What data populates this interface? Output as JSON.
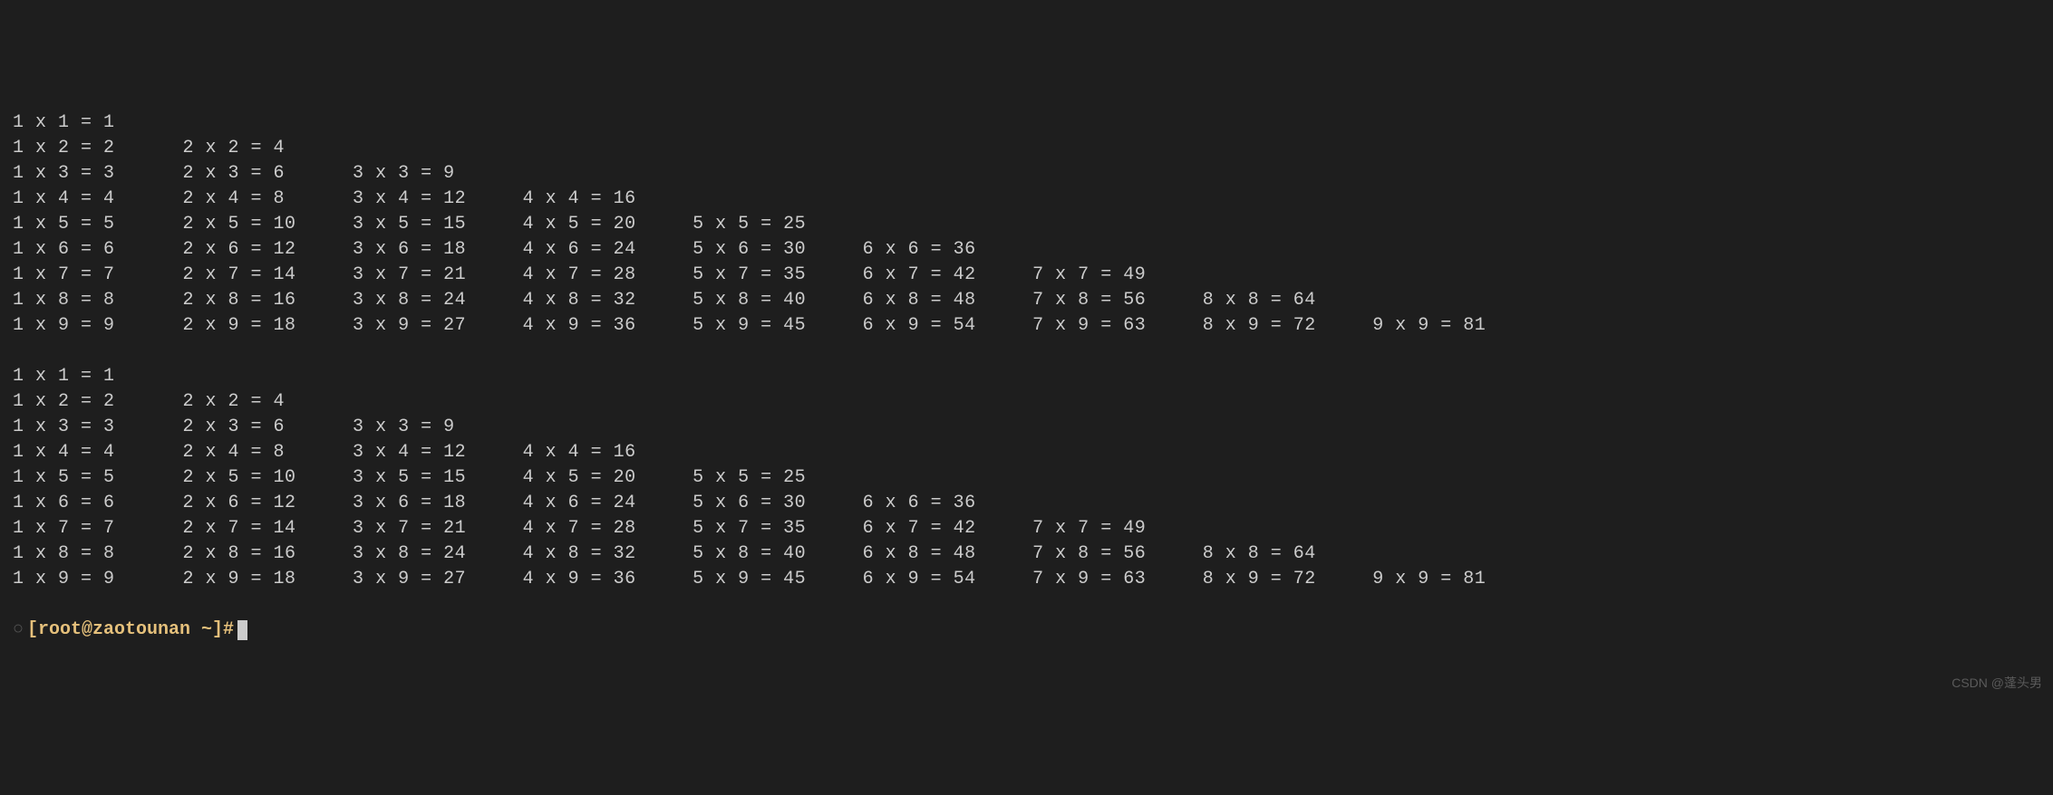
{
  "table1": {
    "rows": [
      [
        {
          "a": 1,
          "b": 1,
          "p": 1
        }
      ],
      [
        {
          "a": 1,
          "b": 2,
          "p": 2
        },
        {
          "a": 2,
          "b": 2,
          "p": 4
        }
      ],
      [
        {
          "a": 1,
          "b": 3,
          "p": 3
        },
        {
          "a": 2,
          "b": 3,
          "p": 6
        },
        {
          "a": 3,
          "b": 3,
          "p": 9
        }
      ],
      [
        {
          "a": 1,
          "b": 4,
          "p": 4
        },
        {
          "a": 2,
          "b": 4,
          "p": 8
        },
        {
          "a": 3,
          "b": 4,
          "p": 12
        },
        {
          "a": 4,
          "b": 4,
          "p": 16
        }
      ],
      [
        {
          "a": 1,
          "b": 5,
          "p": 5
        },
        {
          "a": 2,
          "b": 5,
          "p": 10
        },
        {
          "a": 3,
          "b": 5,
          "p": 15
        },
        {
          "a": 4,
          "b": 5,
          "p": 20
        },
        {
          "a": 5,
          "b": 5,
          "p": 25
        }
      ],
      [
        {
          "a": 1,
          "b": 6,
          "p": 6
        },
        {
          "a": 2,
          "b": 6,
          "p": 12
        },
        {
          "a": 3,
          "b": 6,
          "p": 18
        },
        {
          "a": 4,
          "b": 6,
          "p": 24
        },
        {
          "a": 5,
          "b": 6,
          "p": 30
        },
        {
          "a": 6,
          "b": 6,
          "p": 36
        }
      ],
      [
        {
          "a": 1,
          "b": 7,
          "p": 7
        },
        {
          "a": 2,
          "b": 7,
          "p": 14
        },
        {
          "a": 3,
          "b": 7,
          "p": 21
        },
        {
          "a": 4,
          "b": 7,
          "p": 28
        },
        {
          "a": 5,
          "b": 7,
          "p": 35
        },
        {
          "a": 6,
          "b": 7,
          "p": 42
        },
        {
          "a": 7,
          "b": 7,
          "p": 49
        }
      ],
      [
        {
          "a": 1,
          "b": 8,
          "p": 8
        },
        {
          "a": 2,
          "b": 8,
          "p": 16
        },
        {
          "a": 3,
          "b": 8,
          "p": 24
        },
        {
          "a": 4,
          "b": 8,
          "p": 32
        },
        {
          "a": 5,
          "b": 8,
          "p": 40
        },
        {
          "a": 6,
          "b": 8,
          "p": 48
        },
        {
          "a": 7,
          "b": 8,
          "p": 56
        },
        {
          "a": 8,
          "b": 8,
          "p": 64
        }
      ],
      [
        {
          "a": 1,
          "b": 9,
          "p": 9
        },
        {
          "a": 2,
          "b": 9,
          "p": 18
        },
        {
          "a": 3,
          "b": 9,
          "p": 27
        },
        {
          "a": 4,
          "b": 9,
          "p": 36
        },
        {
          "a": 5,
          "b": 9,
          "p": 45
        },
        {
          "a": 6,
          "b": 9,
          "p": 54
        },
        {
          "a": 7,
          "b": 9,
          "p": 63
        },
        {
          "a": 8,
          "b": 9,
          "p": 72
        },
        {
          "a": 9,
          "b": 9,
          "p": 81
        }
      ]
    ]
  },
  "table2": {
    "rows": [
      [
        {
          "a": 1,
          "b": 1,
          "p": 1
        }
      ],
      [
        {
          "a": 1,
          "b": 2,
          "p": 2
        },
        {
          "a": 2,
          "b": 2,
          "p": 4
        }
      ],
      [
        {
          "a": 1,
          "b": 3,
          "p": 3
        },
        {
          "a": 2,
          "b": 3,
          "p": 6
        },
        {
          "a": 3,
          "b": 3,
          "p": 9
        }
      ],
      [
        {
          "a": 1,
          "b": 4,
          "p": 4
        },
        {
          "a": 2,
          "b": 4,
          "p": 8
        },
        {
          "a": 3,
          "b": 4,
          "p": 12
        },
        {
          "a": 4,
          "b": 4,
          "p": 16
        }
      ],
      [
        {
          "a": 1,
          "b": 5,
          "p": 5
        },
        {
          "a": 2,
          "b": 5,
          "p": 10
        },
        {
          "a": 3,
          "b": 5,
          "p": 15
        },
        {
          "a": 4,
          "b": 5,
          "p": 20
        },
        {
          "a": 5,
          "b": 5,
          "p": 25
        }
      ],
      [
        {
          "a": 1,
          "b": 6,
          "p": 6
        },
        {
          "a": 2,
          "b": 6,
          "p": 12
        },
        {
          "a": 3,
          "b": 6,
          "p": 18
        },
        {
          "a": 4,
          "b": 6,
          "p": 24
        },
        {
          "a": 5,
          "b": 6,
          "p": 30
        },
        {
          "a": 6,
          "b": 6,
          "p": 36
        }
      ],
      [
        {
          "a": 1,
          "b": 7,
          "p": 7
        },
        {
          "a": 2,
          "b": 7,
          "p": 14
        },
        {
          "a": 3,
          "b": 7,
          "p": 21
        },
        {
          "a": 4,
          "b": 7,
          "p": 28
        },
        {
          "a": 5,
          "b": 7,
          "p": 35
        },
        {
          "a": 6,
          "b": 7,
          "p": 42
        },
        {
          "a": 7,
          "b": 7,
          "p": 49
        }
      ],
      [
        {
          "a": 1,
          "b": 8,
          "p": 8
        },
        {
          "a": 2,
          "b": 8,
          "p": 16
        },
        {
          "a": 3,
          "b": 8,
          "p": 24
        },
        {
          "a": 4,
          "b": 8,
          "p": 32
        },
        {
          "a": 5,
          "b": 8,
          "p": 40
        },
        {
          "a": 6,
          "b": 8,
          "p": 48
        },
        {
          "a": 7,
          "b": 8,
          "p": 56
        },
        {
          "a": 8,
          "b": 8,
          "p": 64
        }
      ],
      [
        {
          "a": 1,
          "b": 9,
          "p": 9
        },
        {
          "a": 2,
          "b": 9,
          "p": 18
        },
        {
          "a": 3,
          "b": 9,
          "p": 27
        },
        {
          "a": 4,
          "b": 9,
          "p": 36
        },
        {
          "a": 5,
          "b": 9,
          "p": 45
        },
        {
          "a": 6,
          "b": 9,
          "p": 54
        },
        {
          "a": 7,
          "b": 9,
          "p": 63
        },
        {
          "a": 8,
          "b": 9,
          "p": 72
        },
        {
          "a": 9,
          "b": 9,
          "p": 81
        }
      ]
    ]
  },
  "prompt": {
    "symbol": "○",
    "text": "[root@zaotounan ~]#"
  },
  "watermark": "CSDN @蓬头男"
}
